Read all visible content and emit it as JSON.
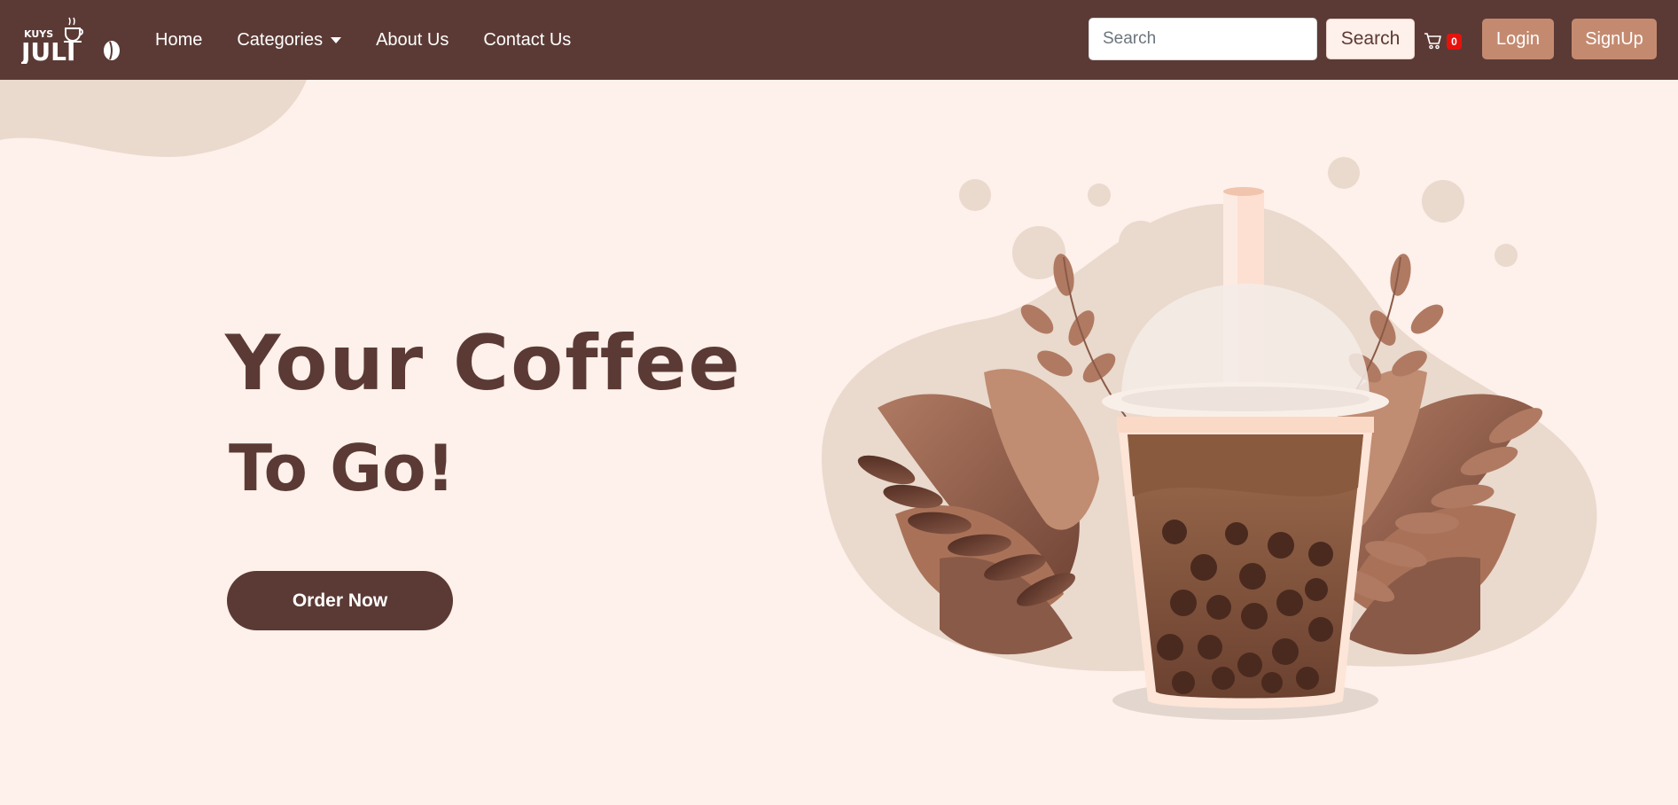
{
  "brand": {
    "name": "JULIO",
    "tagline": "KUYS",
    "logo_icon": "coffee-cup-icon"
  },
  "nav": {
    "home": "Home",
    "categories": "Categories",
    "about": "About Us",
    "contact": "Contact Us"
  },
  "search": {
    "placeholder": "Search",
    "button_label": "Search"
  },
  "cart": {
    "icon": "cart-icon",
    "count": "0"
  },
  "auth": {
    "login_label": "Login",
    "signup_label": "SignUp"
  },
  "hero": {
    "title": "Your Coffee",
    "subtitle": "To Go!",
    "cta_label": "Order Now"
  },
  "colors": {
    "primary_brown": "#5b3a35",
    "accent_tan": "#c48a70",
    "background": "#fef0ea",
    "badge_red": "#e8120c"
  }
}
